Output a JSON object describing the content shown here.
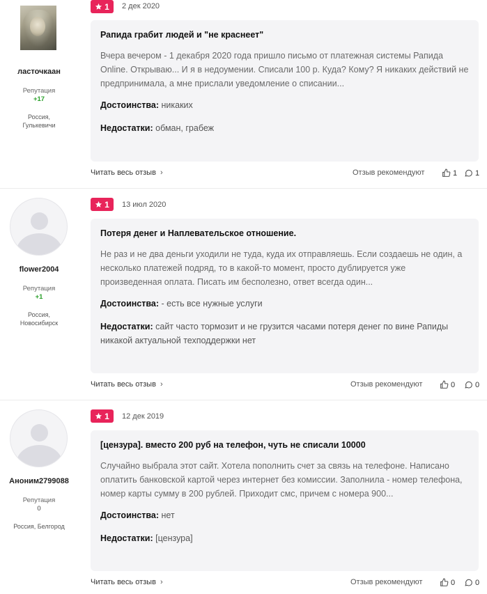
{
  "reviews": [
    {
      "author": "ласточкаан",
      "reputation_label": "Репутация",
      "reputation": "+17",
      "location_country": "Россия,",
      "location_city": "Гулькевичи",
      "rating": "1",
      "date": "2 дек 2020",
      "title": "Рапида грабит людей и \"не краснеет\"",
      "text": "Вчера вечером - 1 декабря 2020 года пришло письмо от платежная системы Рапида Online. Открываю... И я в недоумении. Списали 100 р. Куда? Кому? Я никаких действий не предпринимала, а мне прислали уведомление о списании...",
      "pros_label": "Достоинства:",
      "pros": "никаких",
      "cons_label": "Недостатки:",
      "cons": "обман, грабеж",
      "read_more": "Читать весь отзыв",
      "recommend_label": "Отзыв рекомендуют",
      "likes": "1",
      "comments": "1"
    },
    {
      "author": "flower2004",
      "reputation_label": "Репутация",
      "reputation": "+1",
      "location_country": "Россия,",
      "location_city": "Новосибирск",
      "rating": "1",
      "date": "13 июл 2020",
      "title": "Потеря денег и Наплевательское отношение.",
      "text": "Не раз и не два деньги уходили не туда, куда их отправляешь. Если создаешь не один, а несколько платежей подряд, то в какой-то момент, просто дублируется уже произведенная оплата. Писать им бесполезно, ответ всегда один...",
      "pros_label": "Достоинства:",
      "pros": "- есть все нужные услуги",
      "cons_label": "Недостатки:",
      "cons": "сайт часто тормозит и не грузится часами потеря денег по вине Рапиды никакой актуальной техподдержки нет",
      "read_more": "Читать весь отзыв",
      "recommend_label": "Отзыв рекомендуют",
      "likes": "0",
      "comments": "0"
    },
    {
      "author": "Аноним2799088",
      "reputation_label": "Репутация",
      "reputation": "0",
      "location_country": "Россия, Белгород",
      "location_city": "",
      "rating": "1",
      "date": "12 дек 2019",
      "title": "[цензура]. вместо 200 руб на телефон, чуть не списали 10000",
      "text": "Случайно выбрала этот сайт. Хотела пополнить счет за связь на телефоне. Написано оплатить банковской картой через интернет без комиссии. Заполнила - номер телефона, номер карты сумму в 200 рублей. Приходит смс, причем с номера 900...",
      "pros_label": "Достоинства:",
      "pros": "нет",
      "cons_label": "Недостатки:",
      "cons": "[цензура]",
      "read_more": "Читать весь отзыв",
      "recommend_label": "Отзыв рекомендуют",
      "likes": "0",
      "comments": "0"
    }
  ],
  "colors": {
    "rating_badge": "#e8245a",
    "reputation_positive": "#2ba02b",
    "card_background": "#f4f4f6"
  },
  "icons": {
    "rating": "star-icon",
    "read_more": "chevron-right-icon",
    "likes": "thumbs-up-icon",
    "comments": "comment-icon"
  }
}
